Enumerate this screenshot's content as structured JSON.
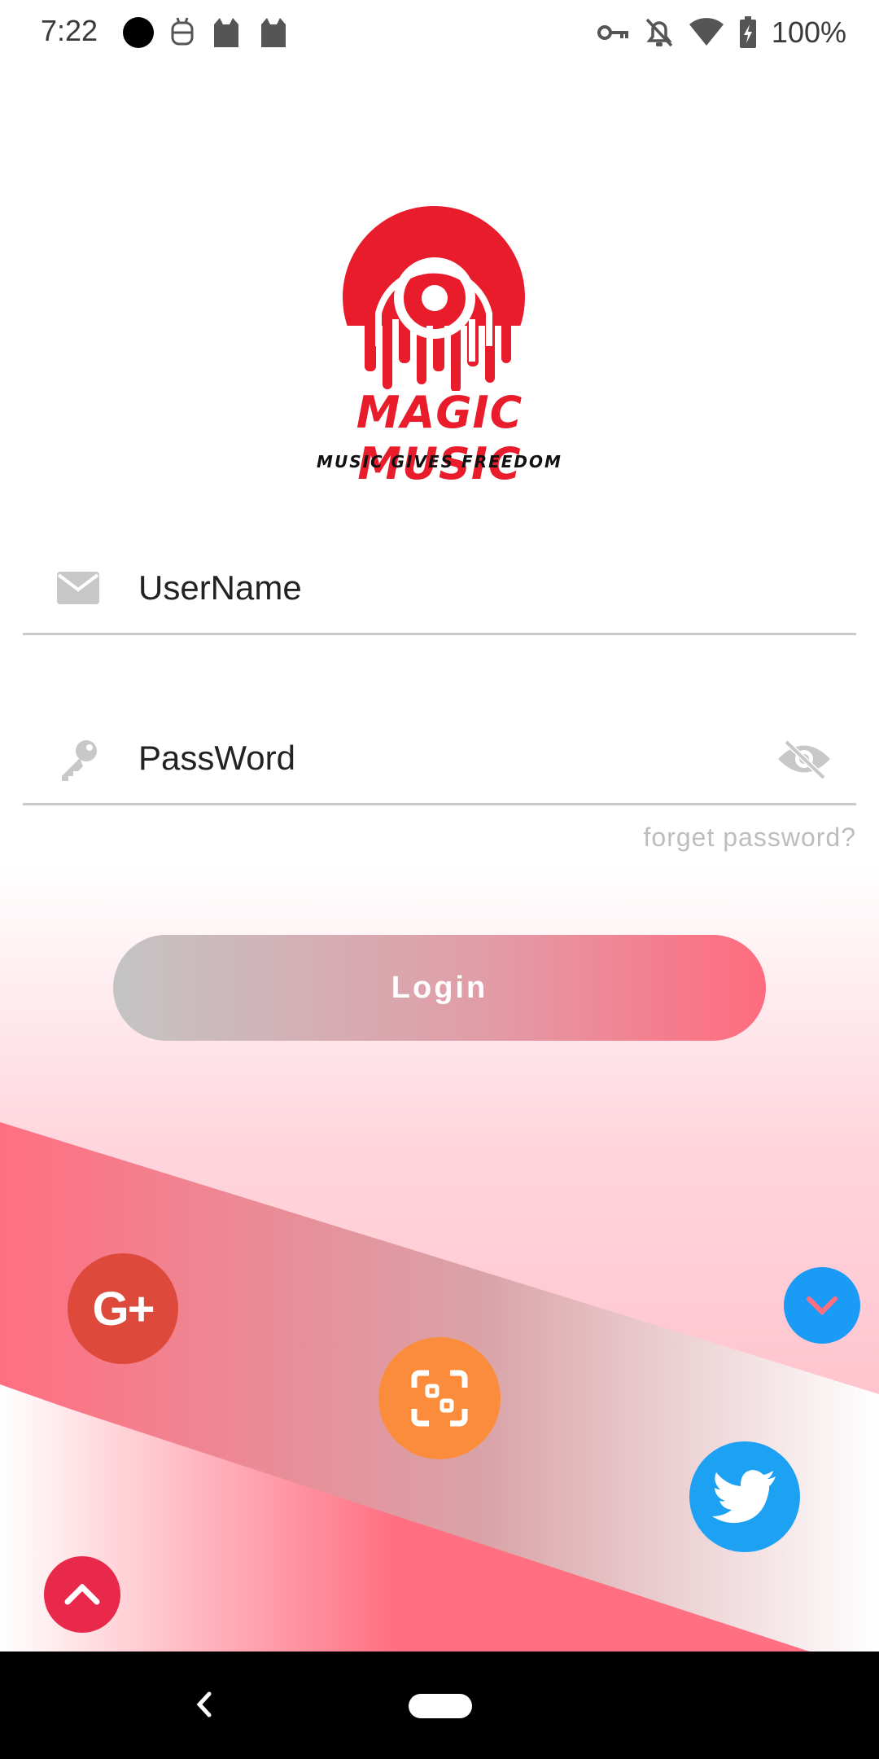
{
  "status_bar": {
    "time": "7:22",
    "battery": "100%",
    "left_icons": [
      "circle-dot-icon",
      "android-robot-icon",
      "cat-icon",
      "cat-icon"
    ],
    "right_icons": [
      "key-icon",
      "bell-off-icon",
      "wifi-icon",
      "battery-charging-icon"
    ]
  },
  "logo": {
    "title": "MAGIC MUSIC",
    "tagline": "MUSIC GIVES FREEDOM",
    "color": "#e81c2b"
  },
  "form": {
    "username_label": "UserName",
    "password_label": "PassWord",
    "forgot_link": "forget password?",
    "login_button": "Login"
  },
  "social": {
    "google_label": "G+",
    "google_color": "#dd4a3c",
    "scan_color": "#fb8c3c",
    "twitter_color": "#1da1f2"
  },
  "colors": {
    "accent_pink": "#ff6b7e",
    "fab_blue": "#1a9bf5",
    "fab_red": "#e8294c"
  }
}
